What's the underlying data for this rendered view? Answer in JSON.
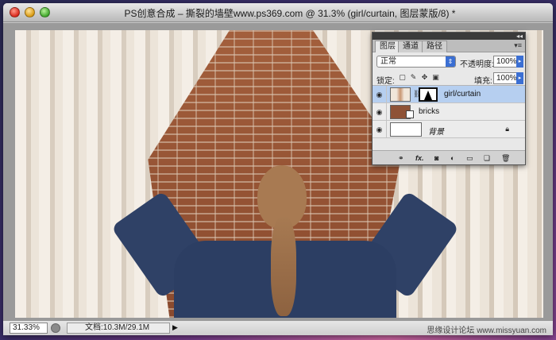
{
  "window": {
    "title": "PS创意合成 – 撕裂的墙壁www.ps369.com @ 31.3% (girl/curtain, 图层蒙版/8) *"
  },
  "statusbar": {
    "zoom": "31.33%",
    "doc_info": "文档:10.3M/29.1M",
    "watermark": "思缘设计论坛 www.missyuan.com"
  },
  "layers_panel": {
    "tabs": [
      "图层",
      "通道",
      "路径"
    ],
    "blend_mode": "正常",
    "opacity_label": "不透明度:",
    "opacity_value": "100%",
    "lock_label": "锁定:",
    "fill_label": "填充:",
    "fill_value": "100%",
    "layers": [
      {
        "name": "girl/curtain",
        "selected": true
      },
      {
        "name": "bricks",
        "selected": false
      },
      {
        "name": "背景",
        "selected": false
      }
    ],
    "footer_icons": [
      "link-icon",
      "fx-icon",
      "mask-icon",
      "adjustment-icon",
      "folder-icon",
      "new-layer-icon",
      "trash-icon"
    ]
  }
}
